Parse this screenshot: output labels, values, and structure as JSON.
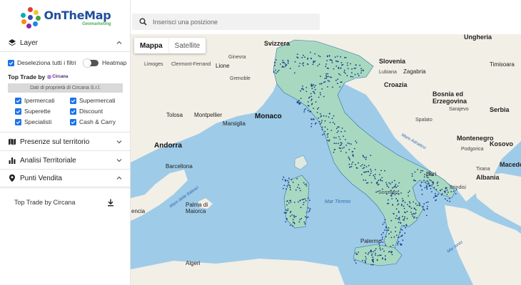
{
  "logo": {
    "title": "OnTheMap",
    "subtitle": "Geomarketing"
  },
  "search": {
    "placeholder": "Inserisci una posizione"
  },
  "sidebar": {
    "layer_label": "Layer",
    "deselect_label": "Deseleziona tutti i filtri",
    "heatmap_label": "Heatmap",
    "trade_title": "Top Trade by",
    "circana_logo": "Circana",
    "data_owner": "Dati di proprietà di Circana S.r.l.",
    "filters": [
      {
        "label": "Ipermercati",
        "checked": true
      },
      {
        "label": "Supermercati",
        "checked": true
      },
      {
        "label": "Superette",
        "checked": true
      },
      {
        "label": "Discount",
        "checked": true
      },
      {
        "label": "Specialisti",
        "checked": true
      },
      {
        "label": "Cash & Carry",
        "checked": true
      }
    ],
    "presenze_label": "Presenze sul territorio",
    "analisi_label": "Analisi Territoriale",
    "punti_label": "Punti Vendita",
    "download_label": "Top Trade by Circana"
  },
  "map": {
    "type_map": "Mappa",
    "type_satellite": "Satellite",
    "labels": {
      "svizzera": "Svizzera",
      "ungheria": "Ungheria",
      "slovenia": "Slovenia",
      "croazia": "Croazia",
      "bosnia": "Bosnia ed Erzegovina",
      "serbia": "Serbia",
      "montenegro": "Montenegro",
      "kosovo": "Kosovo",
      "albania": "Albania",
      "macedonia": "Macedonia",
      "monaco": "Monaco",
      "andorra": "Andorra",
      "barcellona": "Barcellona",
      "palma": "Palma di Maiorca",
      "tolosa": "Tolosa",
      "montpellier": "Montpellier",
      "marsiglia": "Marsiglia",
      "ginevra": "Ginevra",
      "lione": "Lione",
      "zagabria": "Zagabria",
      "sarajevo": "Sarajevo",
      "tirana": "Tirana",
      "algeri": "Algeri",
      "limoges": "Limoges",
      "clermont": "Clermont-Ferrand",
      "grenoble": "Grenoble",
      "valencia": "encia",
      "timisoara": "Timisoara",
      "lubiana": "Lubiana",
      "spalato": "Spalato",
      "podgorica": "Podgorica",
      "bari": "Bari",
      "palermo": "Palermo",
      "sorrento": "Sorrento",
      "brindisi": "Brindisi",
      "tirreno": "Mar Tirreno",
      "baleari": "Mare delle Baleari",
      "adriatico": "Mare Adriatico",
      "ionio": "Mar Ionio"
    }
  },
  "colors": {
    "accent": "#1a73e8",
    "sea": "#9ecbe8",
    "land": "#f2efe6",
    "italy": "#a8d9c0",
    "dots": "#173a8a"
  }
}
